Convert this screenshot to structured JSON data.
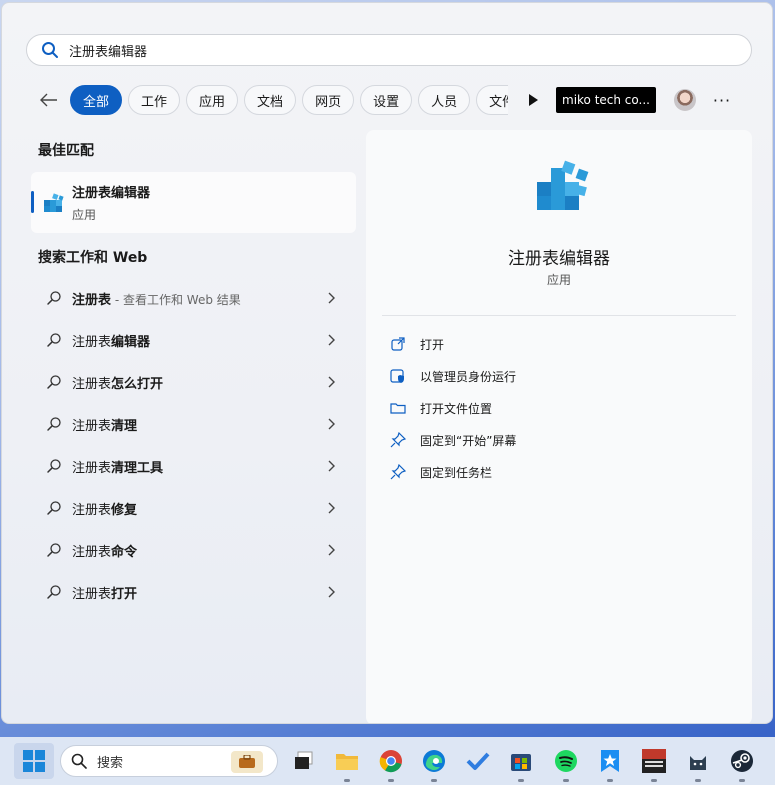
{
  "search": {
    "query": "注册表编辑器"
  },
  "filters": {
    "chips": [
      "全部",
      "工作",
      "应用",
      "文档",
      "网页",
      "设置",
      "人员",
      "文件夹"
    ],
    "account": "miko tech co...",
    "more": "···"
  },
  "best_match": {
    "title": "最佳匹配",
    "app_name": "注册表编辑器",
    "app_type": "应用"
  },
  "web": {
    "title": "搜索工作和 Web",
    "items": [
      {
        "bold": "注册表",
        "rest": "",
        "sub": " - 查看工作和 Web 结果"
      },
      {
        "bold": "",
        "rest": "注册表",
        "tail": "编辑器",
        "sub": ""
      },
      {
        "bold": "",
        "rest": "注册表",
        "tail": "怎么打开",
        "sub": ""
      },
      {
        "bold": "",
        "rest": "注册表",
        "tail": "清理",
        "sub": ""
      },
      {
        "bold": "",
        "rest": "注册表",
        "tail": "清理工具",
        "sub": ""
      },
      {
        "bold": "",
        "rest": "注册表",
        "tail": "修复",
        "sub": ""
      },
      {
        "bold": "",
        "rest": "注册表",
        "tail": "命令",
        "sub": ""
      },
      {
        "bold": "",
        "rest": "注册表",
        "tail": "打开",
        "sub": ""
      }
    ]
  },
  "detail": {
    "name": "注册表编辑器",
    "type": "应用",
    "actions": [
      "打开",
      "以管理员身份运行",
      "打开文件位置",
      "固定到“开始”屏幕",
      "固定到任务栏"
    ]
  },
  "taskbar": {
    "search_label": "搜索",
    "apps": [
      "task-view",
      "file-explorer",
      "chrome",
      "edge",
      "todo",
      "store",
      "spotify",
      "feishu",
      "voicemeeter",
      "cat-app",
      "steam"
    ]
  },
  "colors": {
    "accent": "#0e5fc2"
  }
}
